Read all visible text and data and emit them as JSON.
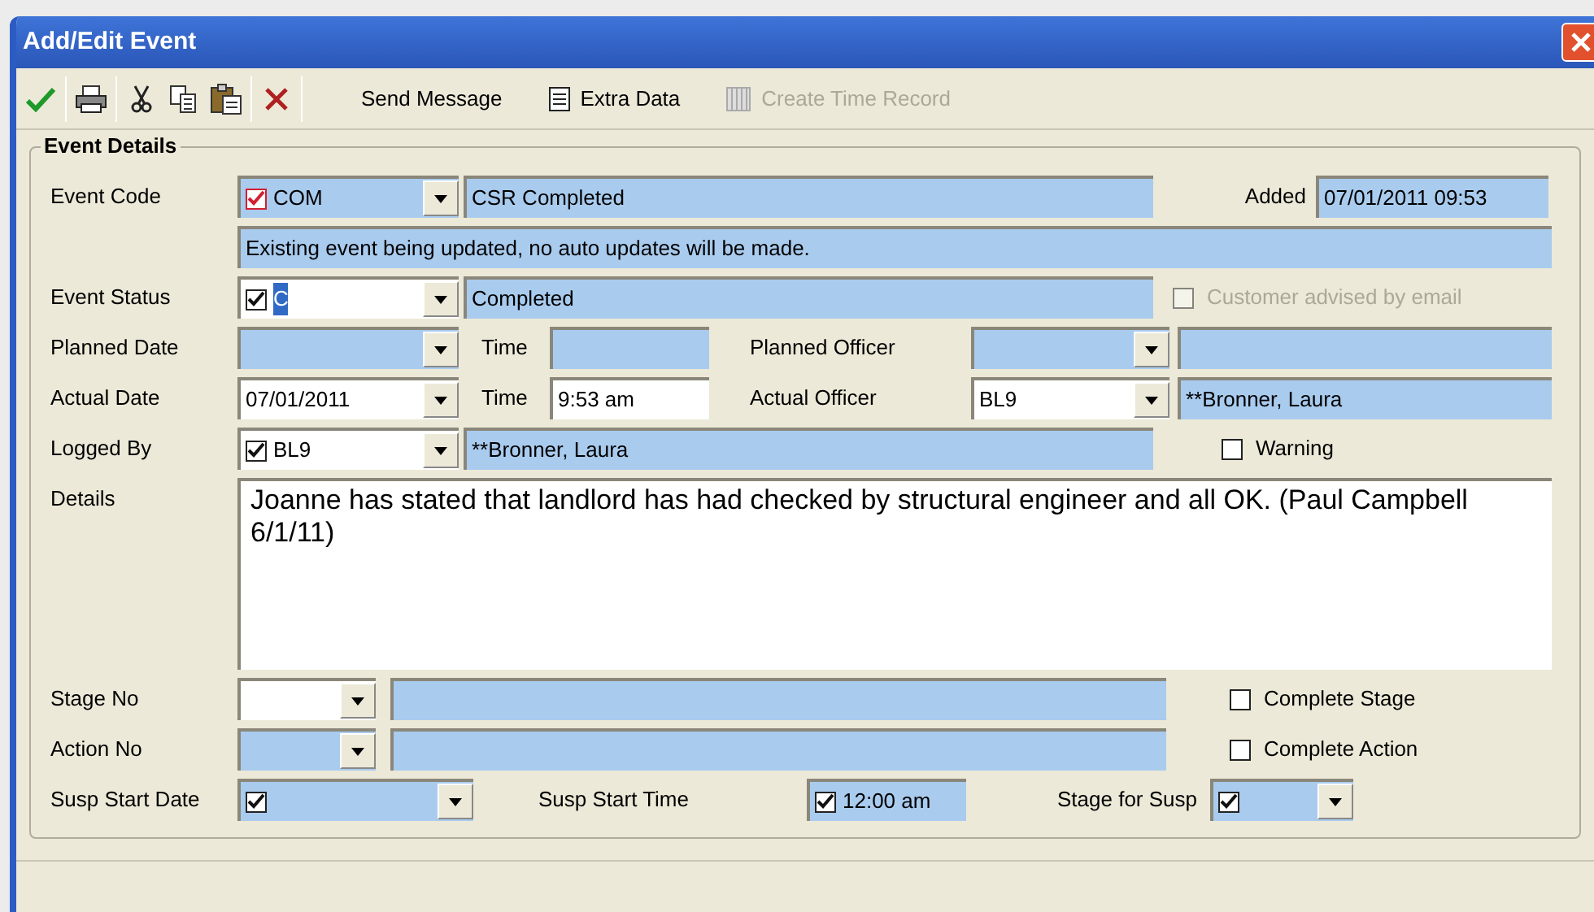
{
  "window": {
    "title": "Add/Edit Event"
  },
  "toolbar": [
    {
      "kind": "save"
    },
    {
      "kind": "separator"
    },
    {
      "kind": "print"
    },
    {
      "kind": "separator"
    },
    {
      "kind": "cut"
    },
    {
      "kind": "copy"
    },
    {
      "kind": "paste"
    },
    {
      "kind": "separator"
    },
    {
      "kind": "delete"
    },
    {
      "kind": "separator"
    },
    {
      "kind": "text",
      "label": "Send Message",
      "disabled": false
    },
    {
      "kind": "document",
      "label": "Extra Data",
      "disabled": false
    },
    {
      "kind": "timesheet",
      "label": "Create Time Record",
      "disabled": true
    }
  ],
  "group": {
    "title": "Event Details"
  },
  "event_code": {
    "label": "Event Code",
    "combo": {
      "value": "COM",
      "checked": true,
      "color": "#d02030",
      "shaded": true
    },
    "description": {
      "value": "CSR Completed"
    },
    "added": {
      "label": "Added",
      "value": "07/01/2011 09:53"
    }
  },
  "notice": {
    "value": "Existing event being updated, no auto updates will be made."
  },
  "event_status": {
    "label": "Event Status",
    "combo": {
      "value": "C",
      "checked": true,
      "shaded": false,
      "value_selected": true
    },
    "description": {
      "value": "Completed"
    },
    "option": {
      "label": "Customer advised by email",
      "checked": false,
      "disabled": true
    }
  },
  "planned": {
    "label": "Planned Date",
    "date": {
      "shaded": true
    },
    "time_label": "Time",
    "time": {
      "shaded": true
    },
    "officer_label": "Planned Officer",
    "officer": {
      "shaded": true
    }
  },
  "actual": {
    "label": "Actual Date",
    "date": {
      "value": "07/01/2011",
      "shaded": false
    },
    "time_label": "Time",
    "time": {
      "value": "9:53 am",
      "shaded": false
    },
    "officer_label": "Actual Officer",
    "officer": {
      "value": "BL9",
      "shaded": false
    },
    "officer_name": {
      "value": "**Bronner, Laura"
    }
  },
  "logged_by": {
    "label": "Logged By",
    "combo": {
      "value": "BL9",
      "checked": true,
      "shaded": false
    },
    "description": {
      "value": "**Bronner, Laura"
    },
    "option": {
      "label": "Warning",
      "checked": false,
      "disabled": false
    }
  },
  "details": {
    "label": "Details",
    "value": "Joanne has stated that landlord has had checked by structural engineer and all OK. (Paul Campbell 6/1/11)"
  },
  "stage": {
    "label": "Stage No",
    "combo": {
      "shaded": false
    },
    "option": {
      "label": "Complete Stage",
      "checked": false,
      "disabled": false
    }
  },
  "action": {
    "label": "Action No",
    "combo": {
      "shaded": true
    },
    "option": {
      "label": "Complete Action",
      "checked": false,
      "disabled": false
    }
  },
  "suspension": {
    "date_label": "Susp Start Date",
    "date": {
      "checked": true,
      "shaded": true
    },
    "time_label": "Susp Start Time",
    "time": {
      "value": "12:00 am",
      "checked": true,
      "shaded": true
    },
    "stage_label": "Stage for Susp",
    "stage": {
      "checked": true,
      "shaded": true
    }
  }
}
